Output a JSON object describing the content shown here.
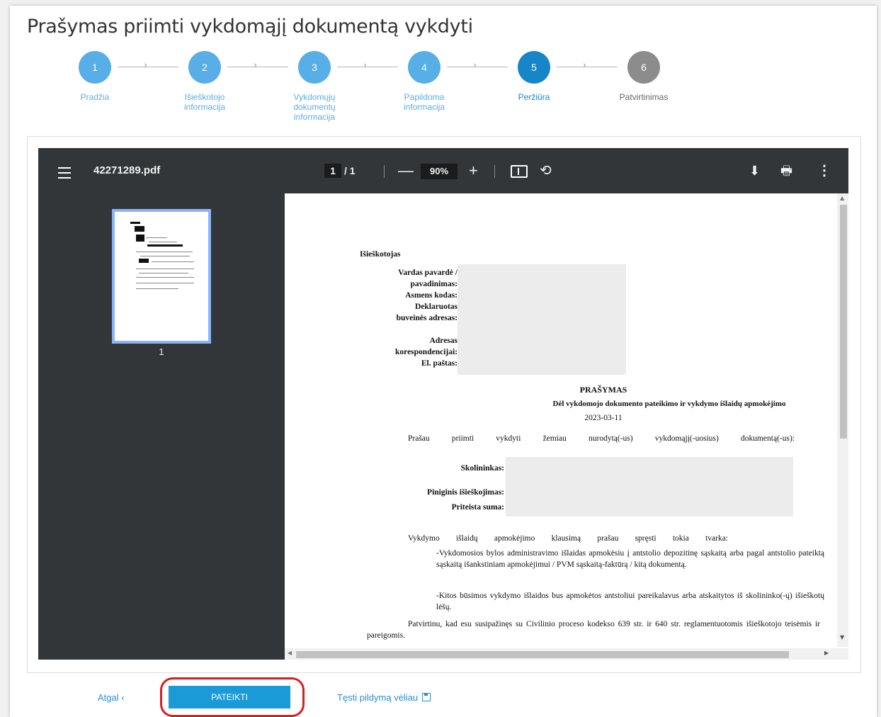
{
  "page": {
    "title": "Prašymas priimti vykdomąjį dokumentą vykdyti"
  },
  "stepper": {
    "steps": [
      {
        "number": "1",
        "label": "Pradžia",
        "state": "done"
      },
      {
        "number": "2",
        "label": "Išieškotojo informacija",
        "state": "done"
      },
      {
        "number": "3",
        "label": "Vykdomųjų dokumentų informacija",
        "state": "done"
      },
      {
        "number": "4",
        "label": "Papildoma informacija",
        "state": "done"
      },
      {
        "number": "5",
        "label": "Peržiūra",
        "state": "active"
      },
      {
        "number": "6",
        "label": "Patvirtinimas",
        "state": "todo"
      }
    ]
  },
  "pdf_viewer": {
    "filename": "42271289.pdf",
    "current_page": "1",
    "page_total": "/ 1",
    "zoom": "90%",
    "zoom_minus": "—",
    "zoom_plus": "+",
    "thumbnail_page": "1",
    "icons": [
      "menu-icon",
      "fit-page-icon",
      "rotate-icon",
      "download-icon",
      "print-icon",
      "more-icon"
    ]
  },
  "document": {
    "claimant_heading": "Išieškotojas",
    "field_name": "Vardas pavardė /",
    "field_name2": "pavadinimas:",
    "field_code": "Asmens kodas:",
    "field_declared": "Deklaruotas",
    "field_declared2": "buveinės adresas:",
    "field_address": "Adresas",
    "field_address2": "korespondencijai:",
    "field_email": "El. paštas:",
    "request_title": "PRAŠYMAS",
    "request_subtitle": "Dėl vykdomojo dokumento pateikimo ir vykdymo išlaidų apmokėjimo",
    "date": "2023-03-11",
    "request_line": "Prašau priimti vykdyti žemiau nurodytą(-us) vykdomąjį(-uosius) dokumentą(-us):",
    "debtor_label": "Skolininkas:",
    "monetary_label": "Piniginis išieškojimas:",
    "awarded_label": "Priteista suma:",
    "costs_line": "Vykdymo išlaidų apmokėjimo klausimą prašau spręsti tokia tvarka:",
    "costs_item1": "-Vykdomosios bylos administravimo išlaidas apmokėsiu į antstolio depozitinę sąskaitą arba pagal antstolio pateiktą sąskaitą išankstiniam apmokėjimui / PVM sąskaitą-faktūrą / kitą dokumentą.",
    "costs_item2": "-Kitos būsimos vykdymo išlaidos bus apmokėtos antstoliui pareikalavus arba atskaitytos iš skolininko(-ų) išieškotų lėšų.",
    "confirm_line": "Patvirtinu, kad esu susipažinęs su Civilinio proceso kodekso 639 str. ir 640 str. reglamentuotomis išieškotojo teisėmis ir pareigomis."
  },
  "actions": {
    "back_label": "Atgal ‹",
    "submit_label": "PATEIKTI",
    "later_label": "Tęsti pildymą vėliau"
  },
  "colors": {
    "step_done": "#58aee6",
    "step_active": "#1686c8",
    "step_todo": "#8c8c8c",
    "submit": "#1a9bd7",
    "highlight": "#d62020",
    "pdf_toolbar": "#323639"
  }
}
